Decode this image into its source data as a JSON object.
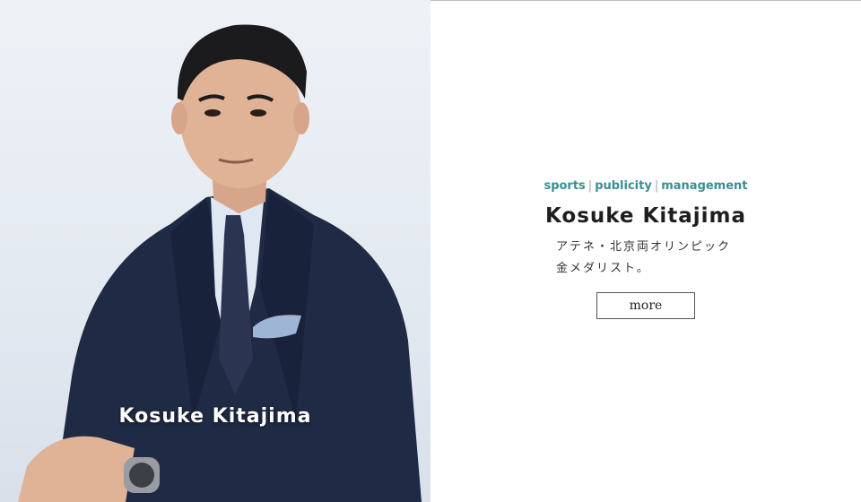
{
  "photo": {
    "caption": "Kosuke Kitajima"
  },
  "profile": {
    "tags": [
      "sports",
      "publicity",
      "management"
    ],
    "separator": "|",
    "name": "Kosuke Kitajima",
    "description_line1": "アテネ・北京両オリンピック",
    "description_line2": "金メダリスト。",
    "more_label": "more"
  },
  "colors": {
    "tag_accent": "#3a8f93",
    "suit": "#1f2a44",
    "background_right": "#ffffff"
  }
}
